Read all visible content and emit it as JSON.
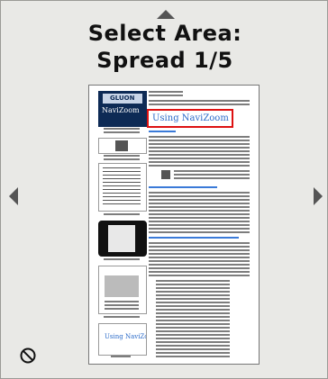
{
  "header": {
    "title_line1": "Select Area:",
    "title_line2": "Spread 1/5"
  },
  "navigation": {
    "up_icon": "triangle-up-icon",
    "left_icon": "triangle-left-icon",
    "right_icon": "triangle-right-icon"
  },
  "page_preview": {
    "logo_brand": "GLUON",
    "logo_product": "NaviZoom",
    "selected_area_label": "Using NaviZoom",
    "footer_thumb_label": "Using NaviZoom"
  },
  "footer": {
    "cancel_icon": "no-entry-icon"
  },
  "colors": {
    "selection_border": "#dd1111",
    "link_blue": "#2b6bc9",
    "background": "#e9e9e6"
  }
}
